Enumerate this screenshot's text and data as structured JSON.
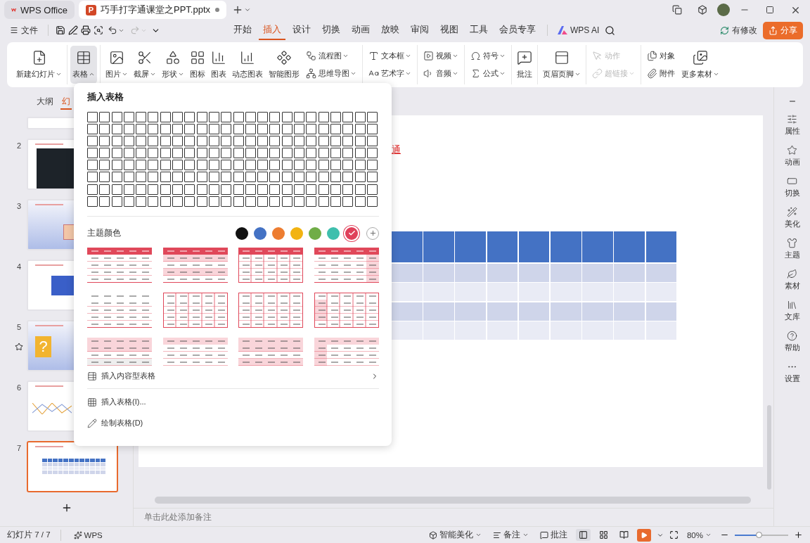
{
  "title_tabs": [
    {
      "label": "WPS Office",
      "selected": false,
      "kind": "home"
    },
    {
      "label": "巧手打字通课堂之PPT.pptx",
      "selected": true,
      "kind": "document",
      "badge": "P",
      "modified": true
    }
  ],
  "file_menu": "文件",
  "menu_tabs": [
    {
      "label": "开始",
      "selected": false
    },
    {
      "label": "插入",
      "selected": true
    },
    {
      "label": "设计",
      "selected": false
    },
    {
      "label": "切换",
      "selected": false
    },
    {
      "label": "动画",
      "selected": false
    },
    {
      "label": "放映",
      "selected": false
    },
    {
      "label": "审阅",
      "selected": false
    },
    {
      "label": "视图",
      "selected": false
    },
    {
      "label": "工具",
      "selected": false
    },
    {
      "label": "会员专享",
      "selected": false
    }
  ],
  "ai_button": "WPS AI",
  "changes_button": "有修改",
  "share_button": "分享",
  "ribbon": [
    {
      "items": [
        {
          "kind": "large",
          "label": "新建幻灯片",
          "dropdown": true,
          "open": false,
          "disabled": false
        }
      ]
    },
    {
      "items": [
        {
          "kind": "large",
          "label": "表格",
          "dropdown": true,
          "open": true,
          "disabled": false
        }
      ]
    },
    {
      "items": [
        {
          "kind": "large",
          "label": "图片",
          "dropdown": true,
          "open": false,
          "disabled": false
        },
        {
          "kind": "large",
          "label": "截屏",
          "dropdown": true,
          "open": false,
          "disabled": false
        },
        {
          "kind": "large",
          "label": "形状",
          "dropdown": true,
          "open": false,
          "disabled": false
        },
        {
          "kind": "large",
          "label": "图标",
          "dropdown": false,
          "disabled": false
        },
        {
          "kind": "large",
          "label": "图表",
          "dropdown": false,
          "disabled": false
        },
        {
          "kind": "large",
          "label": "动态图表",
          "dropdown": false,
          "disabled": false
        },
        {
          "kind": "large",
          "label": "智能图形",
          "dropdown": false,
          "disabled": false
        },
        {
          "kind": "small",
          "label": "流程图",
          "dropdown": true,
          "open": false,
          "disabled": false
        },
        {
          "kind": "small",
          "label": "思维导图",
          "dropdown": true,
          "open": false,
          "disabled": false
        }
      ]
    },
    {
      "items": [
        {
          "kind": "small",
          "label": "文本框",
          "dropdown": true,
          "open": false,
          "disabled": false
        },
        {
          "kind": "small",
          "label": "艺术字",
          "dropdown": true,
          "open": false,
          "disabled": false
        }
      ]
    },
    {
      "items": [
        {
          "kind": "small",
          "label": "视频",
          "dropdown": true,
          "open": false,
          "disabled": false
        },
        {
          "kind": "small",
          "label": "音频",
          "dropdown": true,
          "open": false,
          "disabled": false
        }
      ]
    },
    {
      "items": [
        {
          "kind": "small",
          "label": "符号",
          "dropdown": true,
          "open": false,
          "disabled": false
        },
        {
          "kind": "small",
          "label": "公式",
          "dropdown": true,
          "open": false,
          "disabled": false
        }
      ]
    },
    {
      "items": [
        {
          "kind": "large",
          "label": "批注",
          "dropdown": false,
          "disabled": false
        }
      ]
    },
    {
      "items": [
        {
          "kind": "large",
          "label": "页眉页脚",
          "dropdown": true,
          "open": false,
          "disabled": false
        }
      ]
    },
    {
      "items": [
        {
          "kind": "small",
          "label": "动作",
          "dropdown": false,
          "disabled": true
        },
        {
          "kind": "small",
          "label": "超链接",
          "dropdown": true,
          "open": false,
          "disabled": true
        }
      ]
    },
    {
      "items": [
        {
          "kind": "small",
          "label": "对象",
          "dropdown": false,
          "disabled": false
        },
        {
          "kind": "small",
          "label": "附件",
          "dropdown": false,
          "disabled": false
        },
        {
          "kind": "large",
          "label": "更多素材",
          "dropdown": true,
          "open": false,
          "disabled": false
        }
      ]
    }
  ],
  "panel_tabs": [
    {
      "label": "大纲",
      "selected": false
    },
    {
      "label": "幻",
      "selected": true
    }
  ],
  "slides": [
    {
      "number": "2",
      "kind": "photo",
      "selected": false,
      "animated": false
    },
    {
      "number": "3",
      "kind": "banner",
      "selected": false,
      "animated": false
    },
    {
      "number": "4",
      "kind": "block",
      "selected": false,
      "animated": false
    },
    {
      "number": "5",
      "kind": "question",
      "selected": false,
      "animated": true,
      "tile_text": "?"
    },
    {
      "number": "6",
      "kind": "chart",
      "selected": false,
      "animated": false
    },
    {
      "number": "7",
      "kind": "table",
      "selected": true,
      "animated": false
    }
  ],
  "slide": {
    "title": "通",
    "table": {
      "rows": [
        {
          "kind": "header"
        },
        {
          "kind": "band"
        },
        {
          "kind": "plain"
        },
        {
          "kind": "band"
        },
        {
          "kind": "plain"
        }
      ]
    }
  },
  "insert_table_menu": {
    "title": "插入表格",
    "theme_label": "主题颜色",
    "colors": [
      {
        "color": "#111111",
        "selected": false
      },
      {
        "color": "#4472c4",
        "selected": false
      },
      {
        "color": "#ed7d31",
        "selected": false
      },
      {
        "color": "#f2b311",
        "selected": false
      },
      {
        "color": "#70ad47",
        "selected": false
      },
      {
        "color": "#3fbfad",
        "selected": false
      },
      {
        "color": "#e0405a",
        "selected": true
      }
    ],
    "actions": [
      {
        "label": "插入内容型表格",
        "kind": "submenu"
      },
      {
        "label": "插入表格(I)...",
        "kind": "dialog"
      },
      {
        "label": "绘制表格(D)",
        "kind": "draw"
      }
    ]
  },
  "side_panel": [
    {
      "label": "属性"
    },
    {
      "label": "动画"
    },
    {
      "label": "切换"
    },
    {
      "label": "美化"
    },
    {
      "label": "主题"
    },
    {
      "label": "素材"
    },
    {
      "label": "文库"
    },
    {
      "label": "帮助"
    },
    {
      "label": "设置"
    }
  ],
  "notes_placeholder": "单击此处添加备注",
  "status_bar": {
    "slide_counter": "幻灯片 7 / 7",
    "app": "WPS",
    "beautify": "智能美化",
    "notes": "备注",
    "comments": "批注",
    "views": [
      {
        "selected": true
      },
      {
        "selected": false
      },
      {
        "selected": false
      }
    ],
    "zoom": "80%",
    "zoom_slider": {
      "level": 0.45
    }
  }
}
